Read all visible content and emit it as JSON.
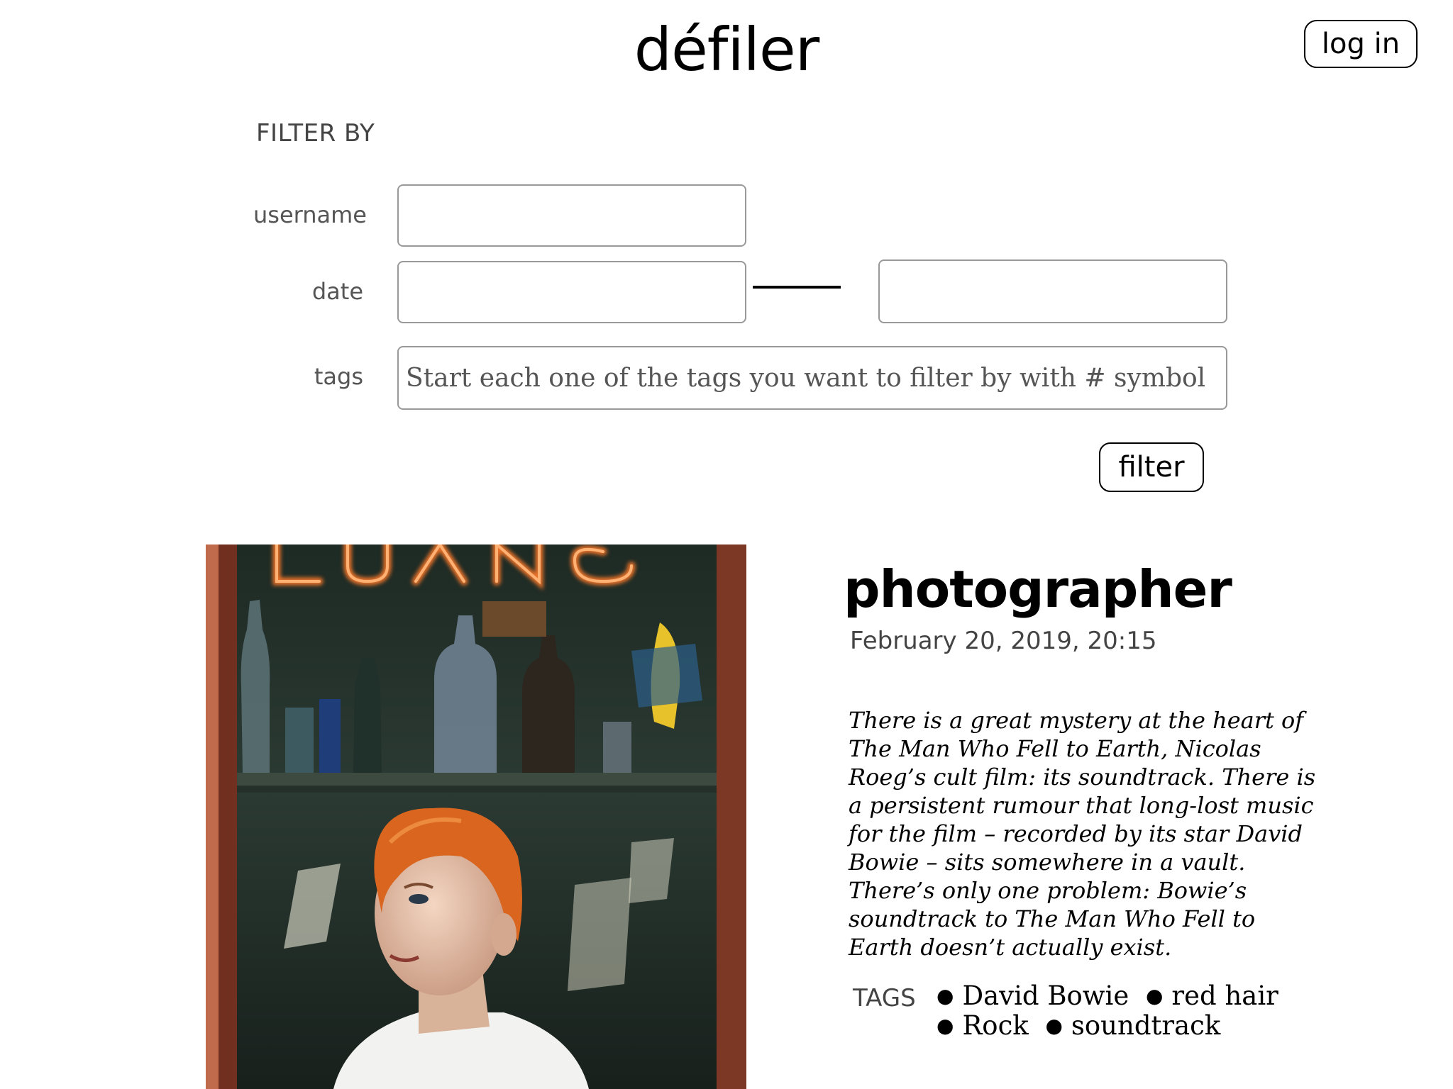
{
  "header": {
    "site_title": "défiler",
    "login_label": "log in"
  },
  "filter": {
    "heading": "FILTER BY",
    "username_label": "username",
    "username_value": "",
    "date_label": "date",
    "date_from_value": "",
    "date_to_value": "",
    "tags_label": "tags",
    "tags_placeholder": "Start each one of the tags you want to filter by with # symbol",
    "filter_button_label": "filter"
  },
  "post": {
    "author": "photographer",
    "date": "February 20, 2019, 20:15",
    "body": "There is a great mystery at the heart of The Man Who Fell to Earth, Nicolas Roeg’s cult film: its soundtrack. There is a persistent rumour that long-lost music for the film – recorded by its star David Bowie – sits somewhere in a vault. There’s only one problem: Bowie’s soundtrack to The Man Who Fell to Earth doesn’t actually exist.",
    "tags_label": "TAGS",
    "tags": [
      "David Bowie",
      "red hair",
      "Rock",
      "soundtrack"
    ],
    "neon_sign_text": "LUANS"
  },
  "colors": {
    "text": "#000000",
    "muted": "#444444",
    "input_border": "#999999",
    "neon": "#ff7a2a",
    "hair": "#d9651f"
  }
}
